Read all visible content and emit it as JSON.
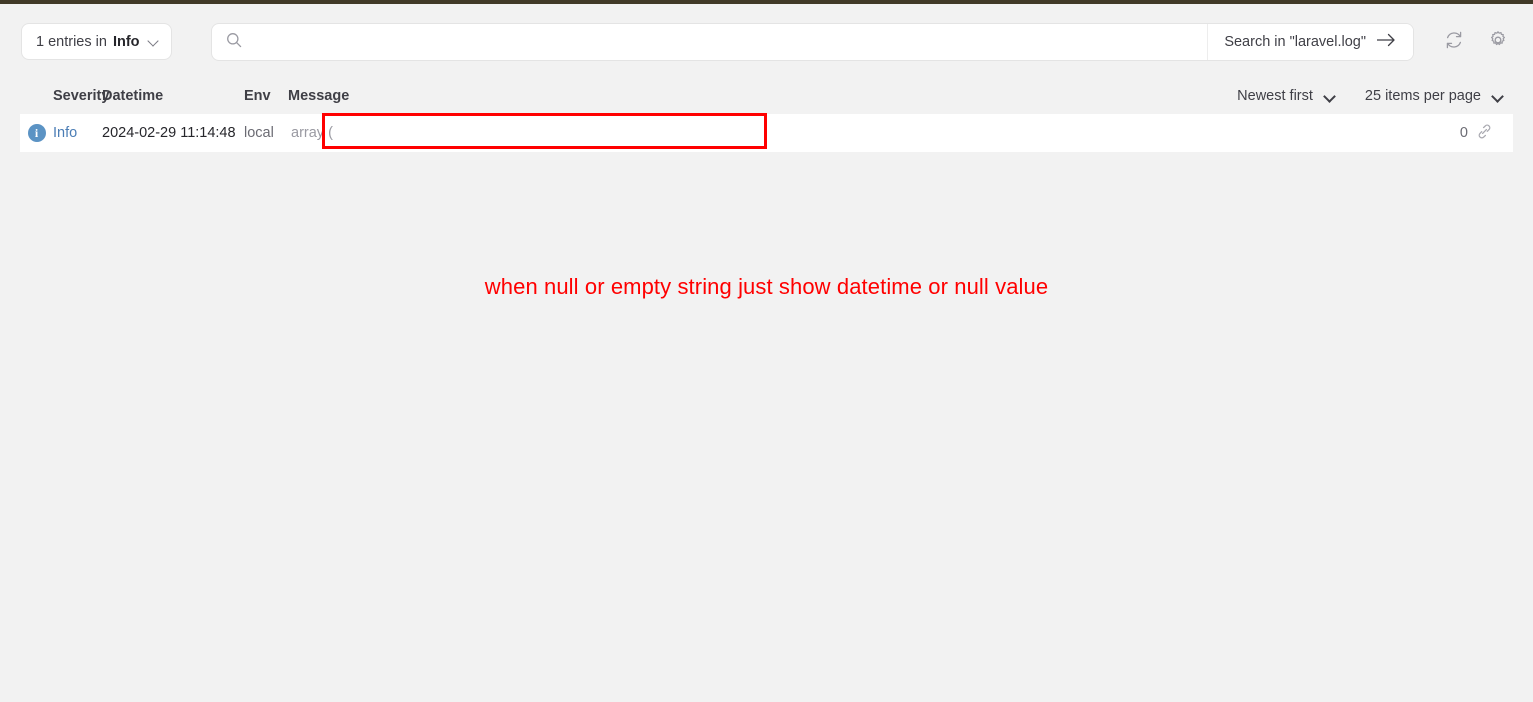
{
  "toolbar": {
    "entries_filter": {
      "prefix": "1 entries in",
      "level": "Info",
      "chevron_icon": "chevron-down-icon"
    },
    "search": {
      "icon": "search-icon",
      "value": "",
      "placeholder": "",
      "submit_label": "Search in \"laravel.log\"",
      "submit_icon": "arrow-right-icon"
    },
    "refresh_icon": "refresh-icon",
    "settings_icon": "gear-icon"
  },
  "table": {
    "columns": {
      "severity": "Severity",
      "datetime": "Datetime",
      "env": "Env",
      "message": "Message"
    },
    "controls": {
      "sort": "Newest first",
      "sort_chevron_icon": "chevron-down-icon",
      "per_page": "25 items per page",
      "per_page_chevron_icon": "chevron-down-icon"
    },
    "rows": [
      {
        "severity_icon": "info-circle-icon",
        "severity_glyph": "i",
        "severity": "Info",
        "datetime": "2024-02-29 11:14:48",
        "env": "local",
        "message": "array (",
        "count": "0",
        "link_icon": "link-icon"
      }
    ]
  },
  "annotation": {
    "text": "when null or empty string just show datetime or null value",
    "color": "#ff0000"
  },
  "highlight": {
    "color": "#ff0000",
    "target": "message-cell"
  },
  "colors": {
    "page_background": "#f2f2f2",
    "row_background": "#ffffff",
    "accent_bar": "#413a28",
    "info_blue": "#5b93c4",
    "link_blue": "#4b7db5"
  }
}
